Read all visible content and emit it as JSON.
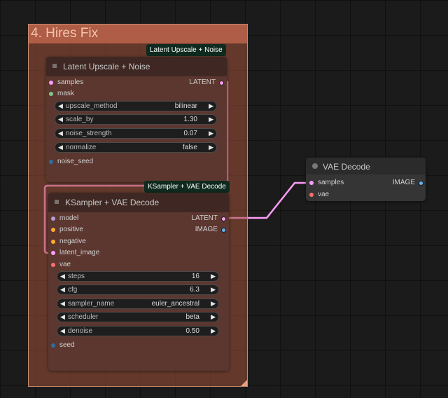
{
  "group": {
    "title": "4. Hires Fix"
  },
  "nodes": {
    "latent_upscale": {
      "badge": "Latent Upscale + Noise",
      "title": "Latent Upscale + Noise",
      "inputs": [
        "samples",
        "mask"
      ],
      "output": "LATENT",
      "widgets": [
        {
          "label": "upscale_method",
          "value": "bilinear"
        },
        {
          "label": "scale_by",
          "value": "1.30"
        },
        {
          "label": "noise_strength",
          "value": "0.07"
        },
        {
          "label": "normalize",
          "value": "false"
        }
      ],
      "extra_input": "noise_seed"
    },
    "ksampler": {
      "badge": "KSampler + VAE Decode",
      "title": "KSampler + VAE Decode",
      "inputs": [
        "model",
        "positive",
        "negative",
        "latent_image",
        "vae"
      ],
      "outputs": [
        "LATENT",
        "IMAGE"
      ],
      "widgets": [
        {
          "label": "steps",
          "value": "16"
        },
        {
          "label": "cfg",
          "value": "6.3"
        },
        {
          "label": "sampler_name",
          "value": "euler_ancestral"
        },
        {
          "label": "scheduler",
          "value": "beta"
        },
        {
          "label": "denoise",
          "value": "0.50"
        }
      ],
      "extra_input": "seed"
    },
    "vae_decode": {
      "title": "VAE Decode",
      "inputs": [
        "samples",
        "vae"
      ],
      "output": "IMAGE"
    }
  },
  "colors": {
    "latent": "#ff9cf9",
    "mask": "#81c784",
    "int": "#2a6fa0",
    "model": "#b39ddb",
    "conditioning": "#ffa931",
    "vae": "#ff6e6e",
    "image": "#64b5f6",
    "link": "#ff9cf9"
  }
}
